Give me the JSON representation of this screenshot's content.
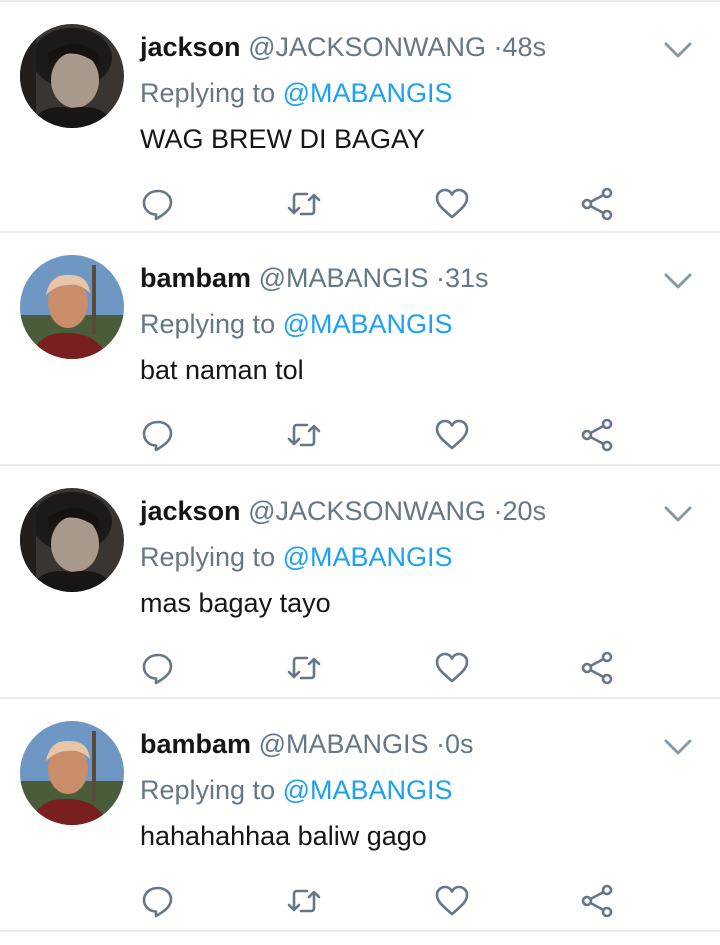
{
  "tweets": [
    {
      "name": "jackson",
      "handle": "@JACKSONWANG",
      "separator": "·",
      "time": "48s",
      "replying_prefix": "Replying to",
      "replying_to": "@MABANGIS",
      "text": "WAG BREW DI BAGAY",
      "avatar": "avatar-jackson"
    },
    {
      "name": "bambam",
      "handle": "@MABANGIS",
      "separator": "·",
      "time": "31s",
      "replying_prefix": "Replying to",
      "replying_to": "@MABANGIS",
      "text": "bat naman tol",
      "avatar": "avatar-bambam"
    },
    {
      "name": "jackson",
      "handle": "@JACKSONWANG",
      "separator": "·",
      "time": "20s",
      "replying_prefix": "Replying to",
      "replying_to": "@MABANGIS",
      "text": "mas bagay tayo",
      "avatar": "avatar-jackson"
    },
    {
      "name": "bambam",
      "handle": "@MABANGIS",
      "separator": "·",
      "time": "0s",
      "replying_prefix": "Replying to",
      "replying_to": "@MABANGIS",
      "text": "hahahahhaa baliw gago",
      "avatar": "avatar-bambam"
    }
  ],
  "icons": {
    "reply": "reply-icon",
    "retweet": "retweet-icon",
    "like": "heart-icon",
    "share": "share-icon",
    "menu": "chevron-down-icon"
  },
  "colors": {
    "name": "#14171a",
    "secondary": "#657786",
    "mention": "#1da1f2",
    "divider": "#e6ecf0"
  }
}
